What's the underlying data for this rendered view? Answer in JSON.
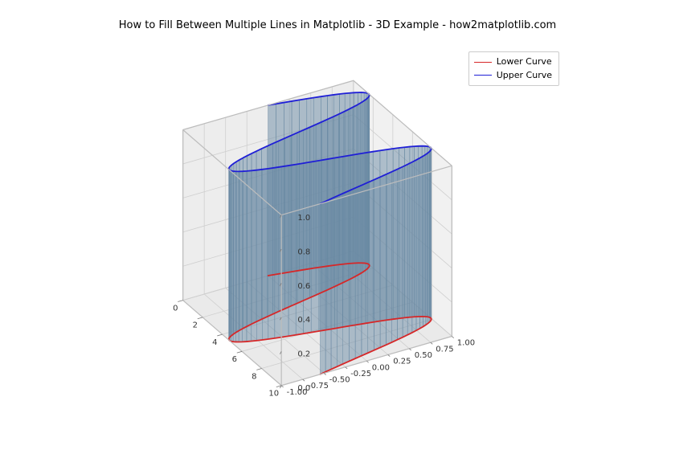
{
  "title": "How to Fill Between Multiple Lines in Matplotlib - 3D Example - how2matplotlib.com",
  "legend": {
    "lower": "Lower Curve",
    "upper": "Upper Curve"
  },
  "chart_data": {
    "type": "line",
    "projection": "3d",
    "title": "How to Fill Between Multiple Lines in Matplotlib - 3D Example - how2matplotlib.com",
    "x_ticks": [
      0,
      2,
      4,
      6,
      8,
      10
    ],
    "y_ticks": [
      -1.0,
      -0.75,
      -0.5,
      -0.25,
      0.0,
      0.25,
      0.5,
      0.75,
      1.0
    ],
    "z_ticks": [
      0.0,
      0.2,
      0.4,
      0.6,
      0.8,
      1.0
    ],
    "x_range": [
      0,
      10
    ],
    "y_range": [
      -1,
      1
    ],
    "z_range": [
      0,
      1
    ],
    "fill_color": "#6a8aa3",
    "fill_alpha": 0.5,
    "series": [
      {
        "name": "Lower Curve",
        "color": "#d62728",
        "formula": "y = sin(x), z = 0",
        "x": [
          0,
          0.785,
          1.571,
          2.356,
          3.142,
          3.927,
          4.712,
          5.498,
          6.283,
          7.069,
          7.854,
          8.639,
          9.425,
          10
        ],
        "y": [
          0.0,
          0.71,
          1.0,
          0.71,
          0.0,
          -0.71,
          -1.0,
          -0.71,
          0.0,
          0.71,
          1.0,
          0.71,
          0.0,
          -0.54
        ],
        "z": [
          0,
          0,
          0,
          0,
          0,
          0,
          0,
          0,
          0,
          0,
          0,
          0,
          0,
          0
        ]
      },
      {
        "name": "Upper Curve",
        "color": "#1f1fd6",
        "formula": "y = sin(x), z = 1",
        "x": [
          0,
          0.785,
          1.571,
          2.356,
          3.142,
          3.927,
          4.712,
          5.498,
          6.283,
          7.069,
          7.854,
          8.639,
          9.425,
          10
        ],
        "y": [
          0.0,
          0.71,
          1.0,
          0.71,
          0.0,
          -0.71,
          -1.0,
          -0.71,
          0.0,
          0.71,
          1.0,
          0.71,
          0.0,
          -0.54
        ],
        "z": [
          1,
          1,
          1,
          1,
          1,
          1,
          1,
          1,
          1,
          1,
          1,
          1,
          1,
          1
        ]
      }
    ]
  }
}
